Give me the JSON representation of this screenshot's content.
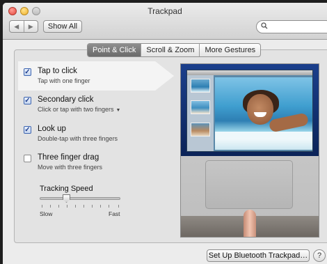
{
  "window": {
    "title": "Trackpad"
  },
  "toolbar": {
    "back_glyph": "◀",
    "forward_glyph": "▶",
    "show_all_label": "Show All",
    "search_icon": "search-icon"
  },
  "tabs": [
    {
      "label": "Point & Click",
      "selected": true
    },
    {
      "label": "Scroll & Zoom",
      "selected": false
    },
    {
      "label": "More Gestures",
      "selected": false
    }
  ],
  "options": [
    {
      "label": "Tap to click",
      "sub": "Tap with one finger",
      "checked": true,
      "has_dropdown": false
    },
    {
      "label": "Secondary click",
      "sub": "Click or tap with two fingers",
      "checked": true,
      "has_dropdown": true
    },
    {
      "label": "Look up",
      "sub": "Double-tap with three fingers",
      "checked": true,
      "has_dropdown": false
    },
    {
      "label": "Three finger drag",
      "sub": "Move with three fingers",
      "checked": false,
      "has_dropdown": false
    }
  ],
  "tracking": {
    "label": "Tracking Speed",
    "min_label": "Slow",
    "max_label": "Fast",
    "value_fraction": 0.3
  },
  "bottom": {
    "bluetooth_label": "Set Up Bluetooth Trackpad…",
    "help_label": "?"
  }
}
